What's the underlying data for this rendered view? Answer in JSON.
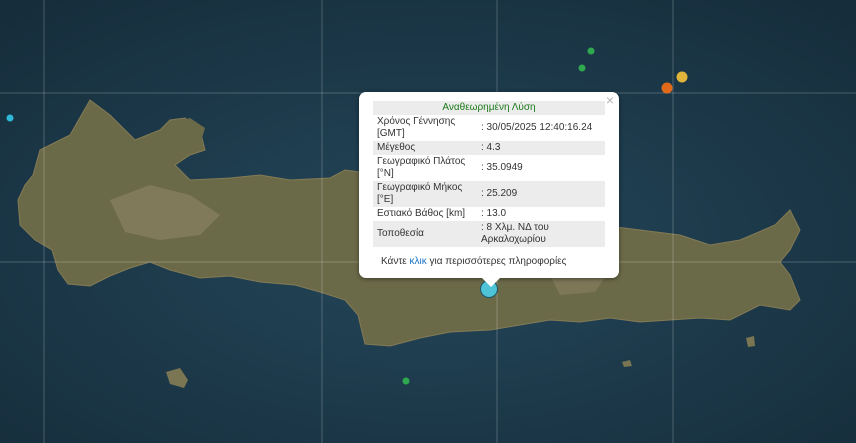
{
  "map": {
    "colors": {
      "sea": "#1e3a4b",
      "land": "#6b6a48",
      "mountain": "#8a8163",
      "grid": "#ffffff"
    },
    "markers": [
      {
        "name": "main-epicenter-marker",
        "color": "#4fc3d6",
        "size": "large"
      },
      {
        "name": "event-marker",
        "color": "#2fa84f"
      },
      {
        "name": "event-marker",
        "color": "#2fa84f"
      },
      {
        "name": "event-marker",
        "color": "#e06a1a"
      },
      {
        "name": "event-marker",
        "color": "#e0b43a"
      },
      {
        "name": "event-marker",
        "color": "#2fb8d8"
      },
      {
        "name": "event-marker",
        "color": "#2fa84f"
      }
    ]
  },
  "popup": {
    "header": "Αναθεωρημένη Λύση",
    "close_icon": "close-icon",
    "rows": [
      {
        "label": "Χρόνος Γέννησης [GMT]",
        "value": ": 30/05/2025 12:40:16.24"
      },
      {
        "label": "Μέγεθος",
        "value": ": 4.3"
      },
      {
        "label": "Γεωγραφικό Πλάτος [°N]",
        "value": ": 35.0949"
      },
      {
        "label": "Γεωγραφικό Μήκος [°E]",
        "value": ": 25.209"
      },
      {
        "label": "Εστιακό Βάθος [km]",
        "value": ": 13.0"
      },
      {
        "label": "Τοποθεσία",
        "value": ": 8 Χλμ. ΝΔ του Αρκαλοχωρίου"
      }
    ],
    "more_prefix": "Κάντε ",
    "more_link": "κλικ",
    "more_suffix": " για περισσότερες πληροφορίες"
  }
}
